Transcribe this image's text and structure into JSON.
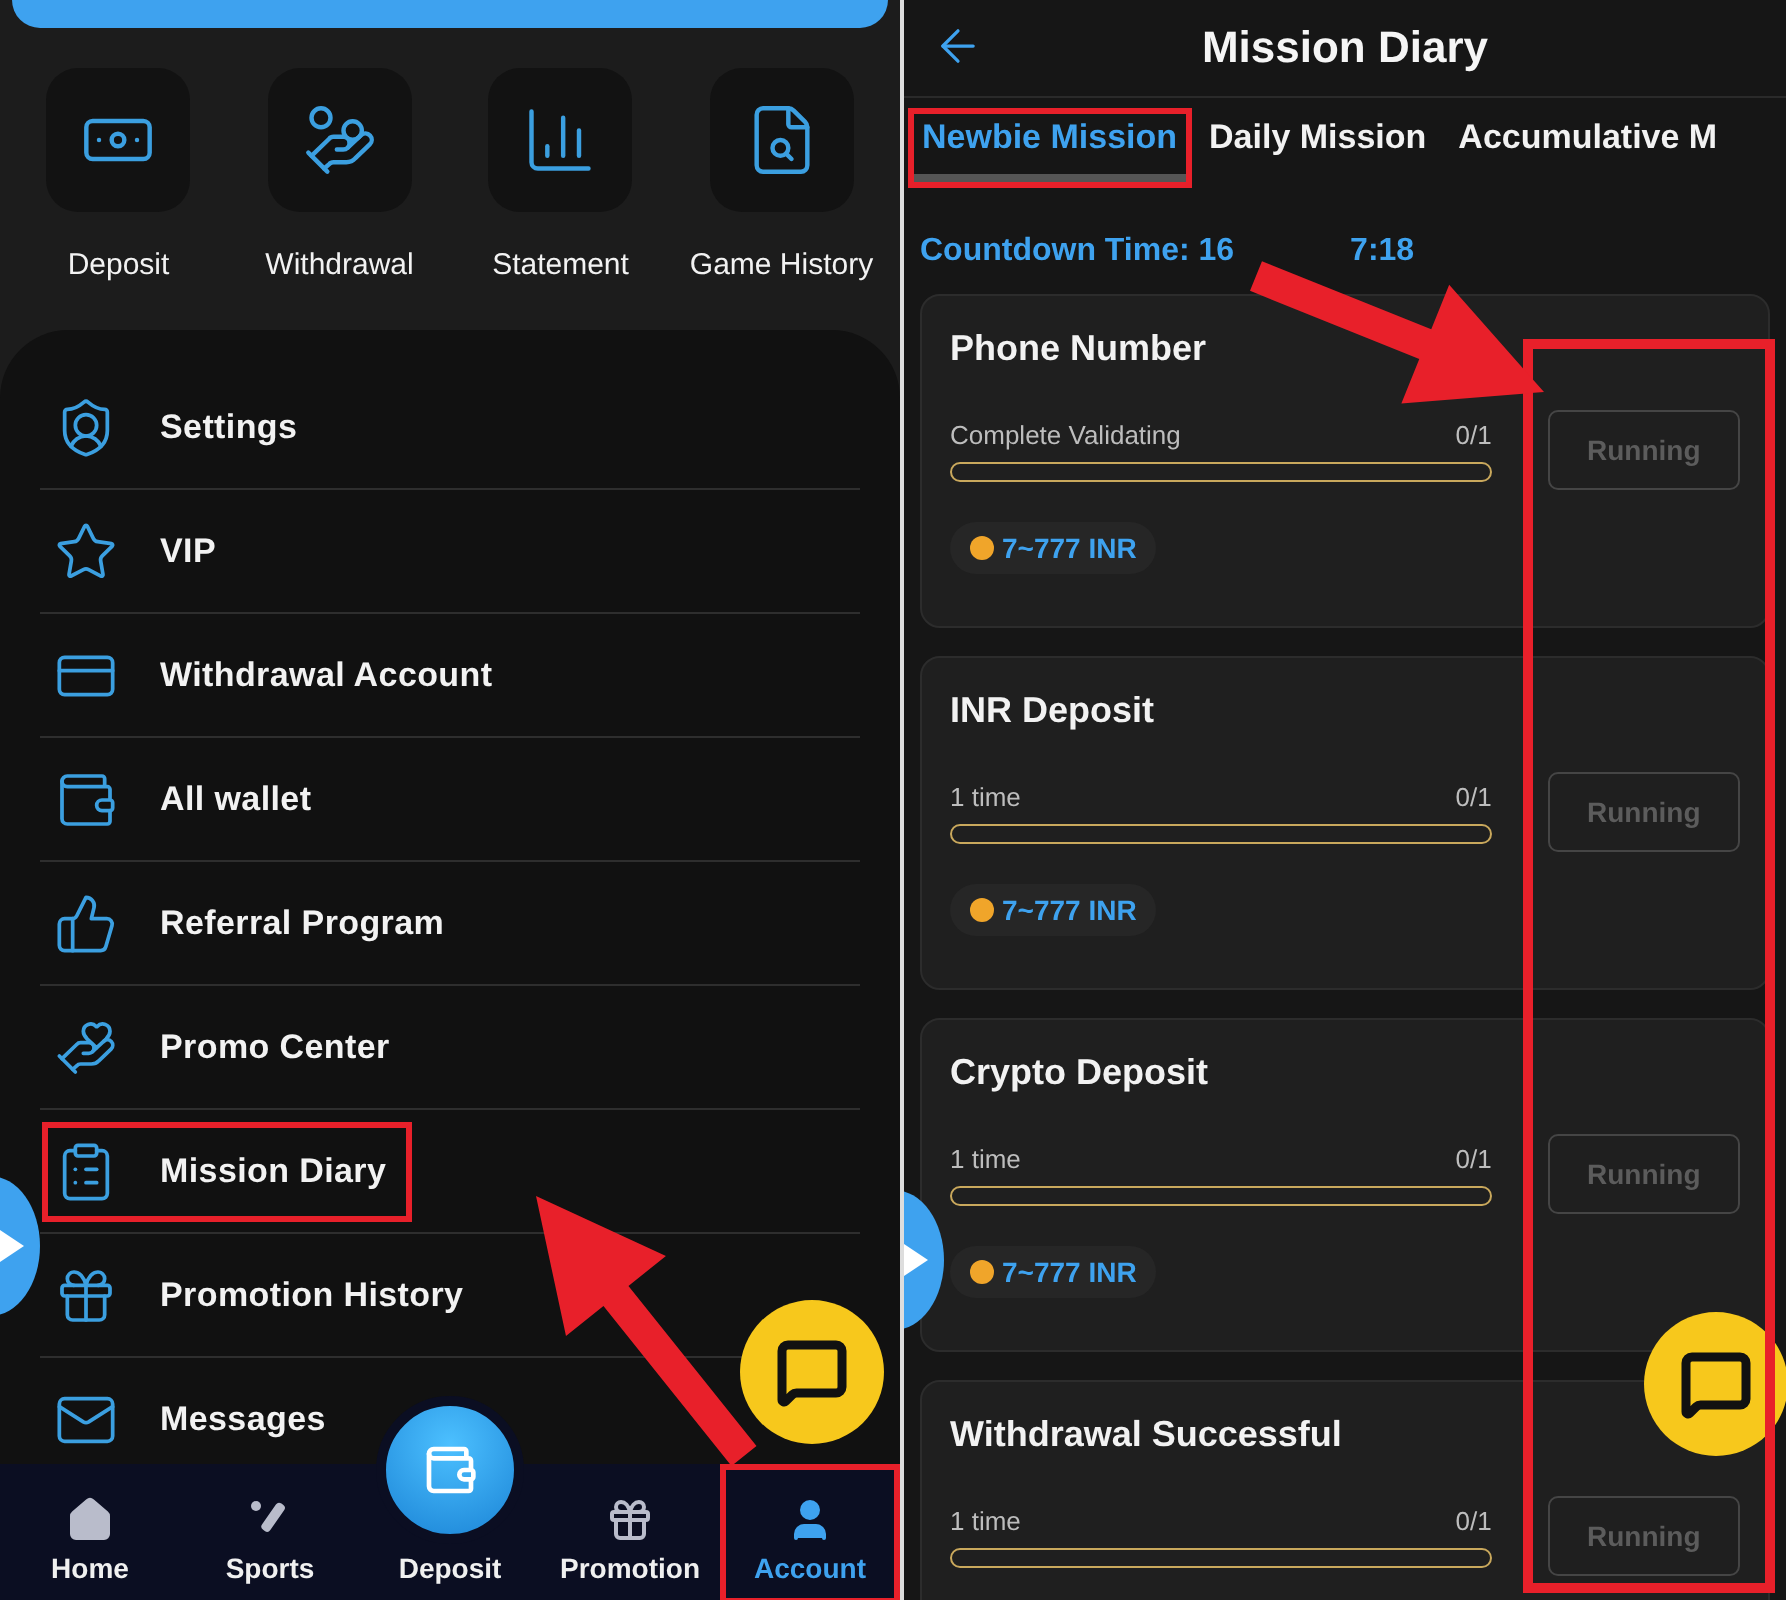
{
  "account_screen": {
    "quick_actions": [
      "Deposit",
      "Withdrawal",
      "Statement",
      "Game History"
    ],
    "menu_items": [
      {
        "label": "Settings",
        "highlighted": false
      },
      {
        "label": "VIP",
        "highlighted": false
      },
      {
        "label": "Withdrawal Account",
        "highlighted": false
      },
      {
        "label": "All wallet",
        "highlighted": false
      },
      {
        "label": "Referral Program",
        "highlighted": false
      },
      {
        "label": "Promo Center",
        "highlighted": false
      },
      {
        "label": "Mission Diary",
        "highlighted": true
      },
      {
        "label": "Promotion History",
        "highlighted": false
      },
      {
        "label": "Messages",
        "highlighted": false
      }
    ],
    "bottom_nav": [
      {
        "label": "Home",
        "selected": false,
        "highlighted": false
      },
      {
        "label": "Sports",
        "selected": false,
        "highlighted": false
      },
      {
        "label": "Deposit",
        "selected": false,
        "highlighted": false
      },
      {
        "label": "Promotion",
        "selected": false,
        "highlighted": false
      },
      {
        "label": "Account",
        "selected": true,
        "highlighted": true
      }
    ]
  },
  "mission_screen": {
    "title": "Mission Diary",
    "tabs": [
      {
        "label": "Newbie Mission",
        "selected": true,
        "highlighted": true
      },
      {
        "label": "Daily Mission",
        "selected": false,
        "highlighted": false
      },
      {
        "label": "Accumulative M",
        "selected": false,
        "highlighted": false
      }
    ],
    "countdown_label": "Countdown Time: 16",
    "countdown_rest": "7:18",
    "missions": [
      {
        "title": "Phone Number",
        "requirement": "Complete Validating",
        "progress": "0/1",
        "level": 0,
        "reward": "7~777 INR",
        "status": "Running"
      },
      {
        "title": "INR Deposit",
        "requirement": "1 time",
        "progress": "0/1",
        "level": 0,
        "reward": "7~777 INR",
        "status": "Running"
      },
      {
        "title": "Crypto Deposit",
        "requirement": "1 time",
        "progress": "0/1",
        "level": 0,
        "reward": "7~777 INR",
        "status": "Running"
      },
      {
        "title": "Withdrawal Successful",
        "requirement": "1 time",
        "progress": "0/1",
        "level": 0,
        "status": "Running"
      }
    ]
  }
}
